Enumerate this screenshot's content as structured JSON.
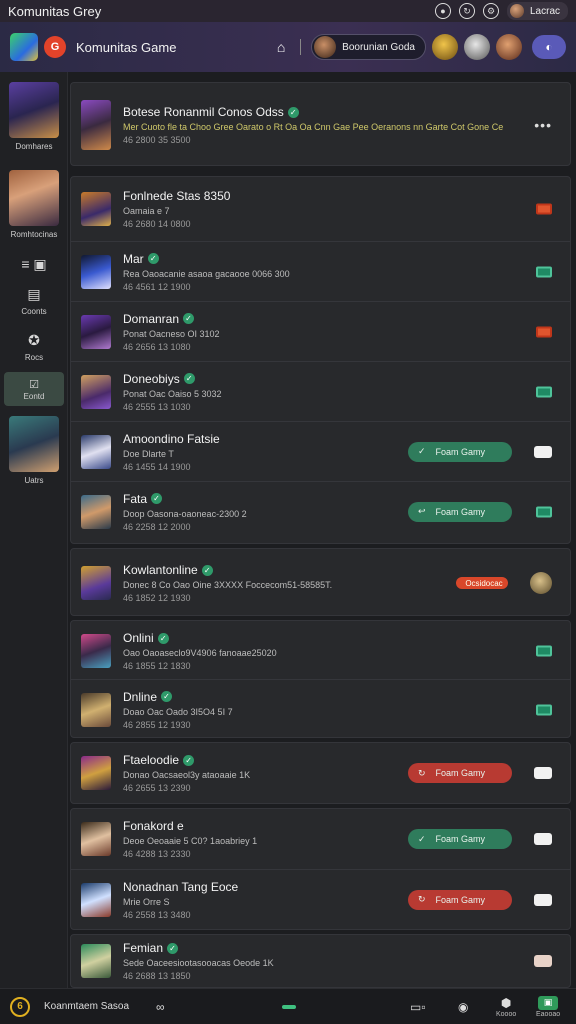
{
  "os_bar": {
    "title": "Komunitas Grey",
    "user_label": "Lacrac"
  },
  "header": {
    "app_title": "Komunitas Game",
    "profile_label": "Boorunian Goda"
  },
  "sidebar": {
    "items": [
      {
        "label": "Domhares"
      },
      {
        "label": "Romhtocinas"
      },
      {
        "label": "Coonts"
      },
      {
        "label": "Rocs"
      },
      {
        "label": "Eontd"
      },
      {
        "label": "Uatrs"
      }
    ]
  },
  "top_card": {
    "name": "Botese Ronanmil Conos Odss",
    "line1": "Mer Cuoto fle ta Choo Gree Oarato o Rt Oa Oa Cnn Gae Pee Oeranons nn Garte Cot Gone Ceonnolls Gt Gre 25",
    "line2": "46 2800 35 3500"
  },
  "rows": [
    {
      "name": "Fonlnede Stas 8350",
      "line1": "Oamaia e 7",
      "line2": "46 2680 14 0800",
      "status": "red"
    },
    {
      "name": "Mar",
      "line1": "Rea Oaoacanie asaoa gacaooe 0066 300",
      "line2": "46 4561 12 1900",
      "status": "green"
    },
    {
      "name": "Domanran",
      "line1": "Ponat Oacneso OI 3102",
      "line2": "46 2656 13 1080",
      "status": "red"
    },
    {
      "name": "Doneobiys",
      "line1": "Ponat Oac Oaiso 5 3032",
      "line2": "46 2555 13 1030",
      "status": "green"
    },
    {
      "name": "Amoondino Fatsie",
      "line1": "Doe Dlarte T",
      "line2": "46 1455 14 1900",
      "status": "white",
      "pill": "green",
      "pill_text": "Foam Gamy"
    },
    {
      "name": "Fata",
      "line1": "Doop Oasona-oaoneac-2300 2",
      "line2": "46 2258 12 2000",
      "status": "green",
      "pill": "green",
      "pill_text": "Foam Gamy"
    },
    {
      "name": "Kowlantonline",
      "line1": "Donec 8 Co Oao Oine 3XXXX Foccecom51-58585T.",
      "line2": "46 1852 12 1930",
      "status": "avatar",
      "tag": "Ocsidocac"
    },
    {
      "name": "Onlini",
      "line1": "Oao Oaoaseclo9V4906 fanoaae25020",
      "line2": "46 1855 12 1830",
      "status": "green"
    },
    {
      "name": "Dnline",
      "line1": "Doao Oac Oado 3I5O4 5I 7",
      "line2": "46 2855 12 1930",
      "status": "green"
    },
    {
      "name": "Ftaeloodie",
      "line1": "Donao Oacsaeol3y ataoaaie 1K",
      "line2": "46 2655 13 2390",
      "status": "white",
      "pill": "red",
      "pill_text": "Foam Gamy"
    },
    {
      "name": "Fonakord e",
      "line1": "Deoe Oeoaaie 5 C0? 1aoabriey 1",
      "line2": "46 4288 13 2330",
      "status": "white",
      "pill": "green",
      "pill_text": "Foam Gamy"
    },
    {
      "name": "Nonadnan Tang Eoce",
      "line1": "Mrie Orre S",
      "line2": "46 2558 13 3480",
      "status": "white",
      "pill": "red",
      "pill_text": "Foam Gamy"
    },
    {
      "name": "Femian",
      "line1": "Sede Oaceesiootasooacas Oeode 1K",
      "line2": "46 2688 13 1850",
      "status": "peach"
    }
  ],
  "bottom_bar": {
    "label": "Koanmtaem Sasoa",
    "items": [
      {
        "label": "Koooo"
      },
      {
        "label": "Eaooao"
      }
    ]
  },
  "colors": {
    "accent_green": "#2f7c5c",
    "accent_red": "#b83a32",
    "header_purple": "#3b2f52"
  }
}
